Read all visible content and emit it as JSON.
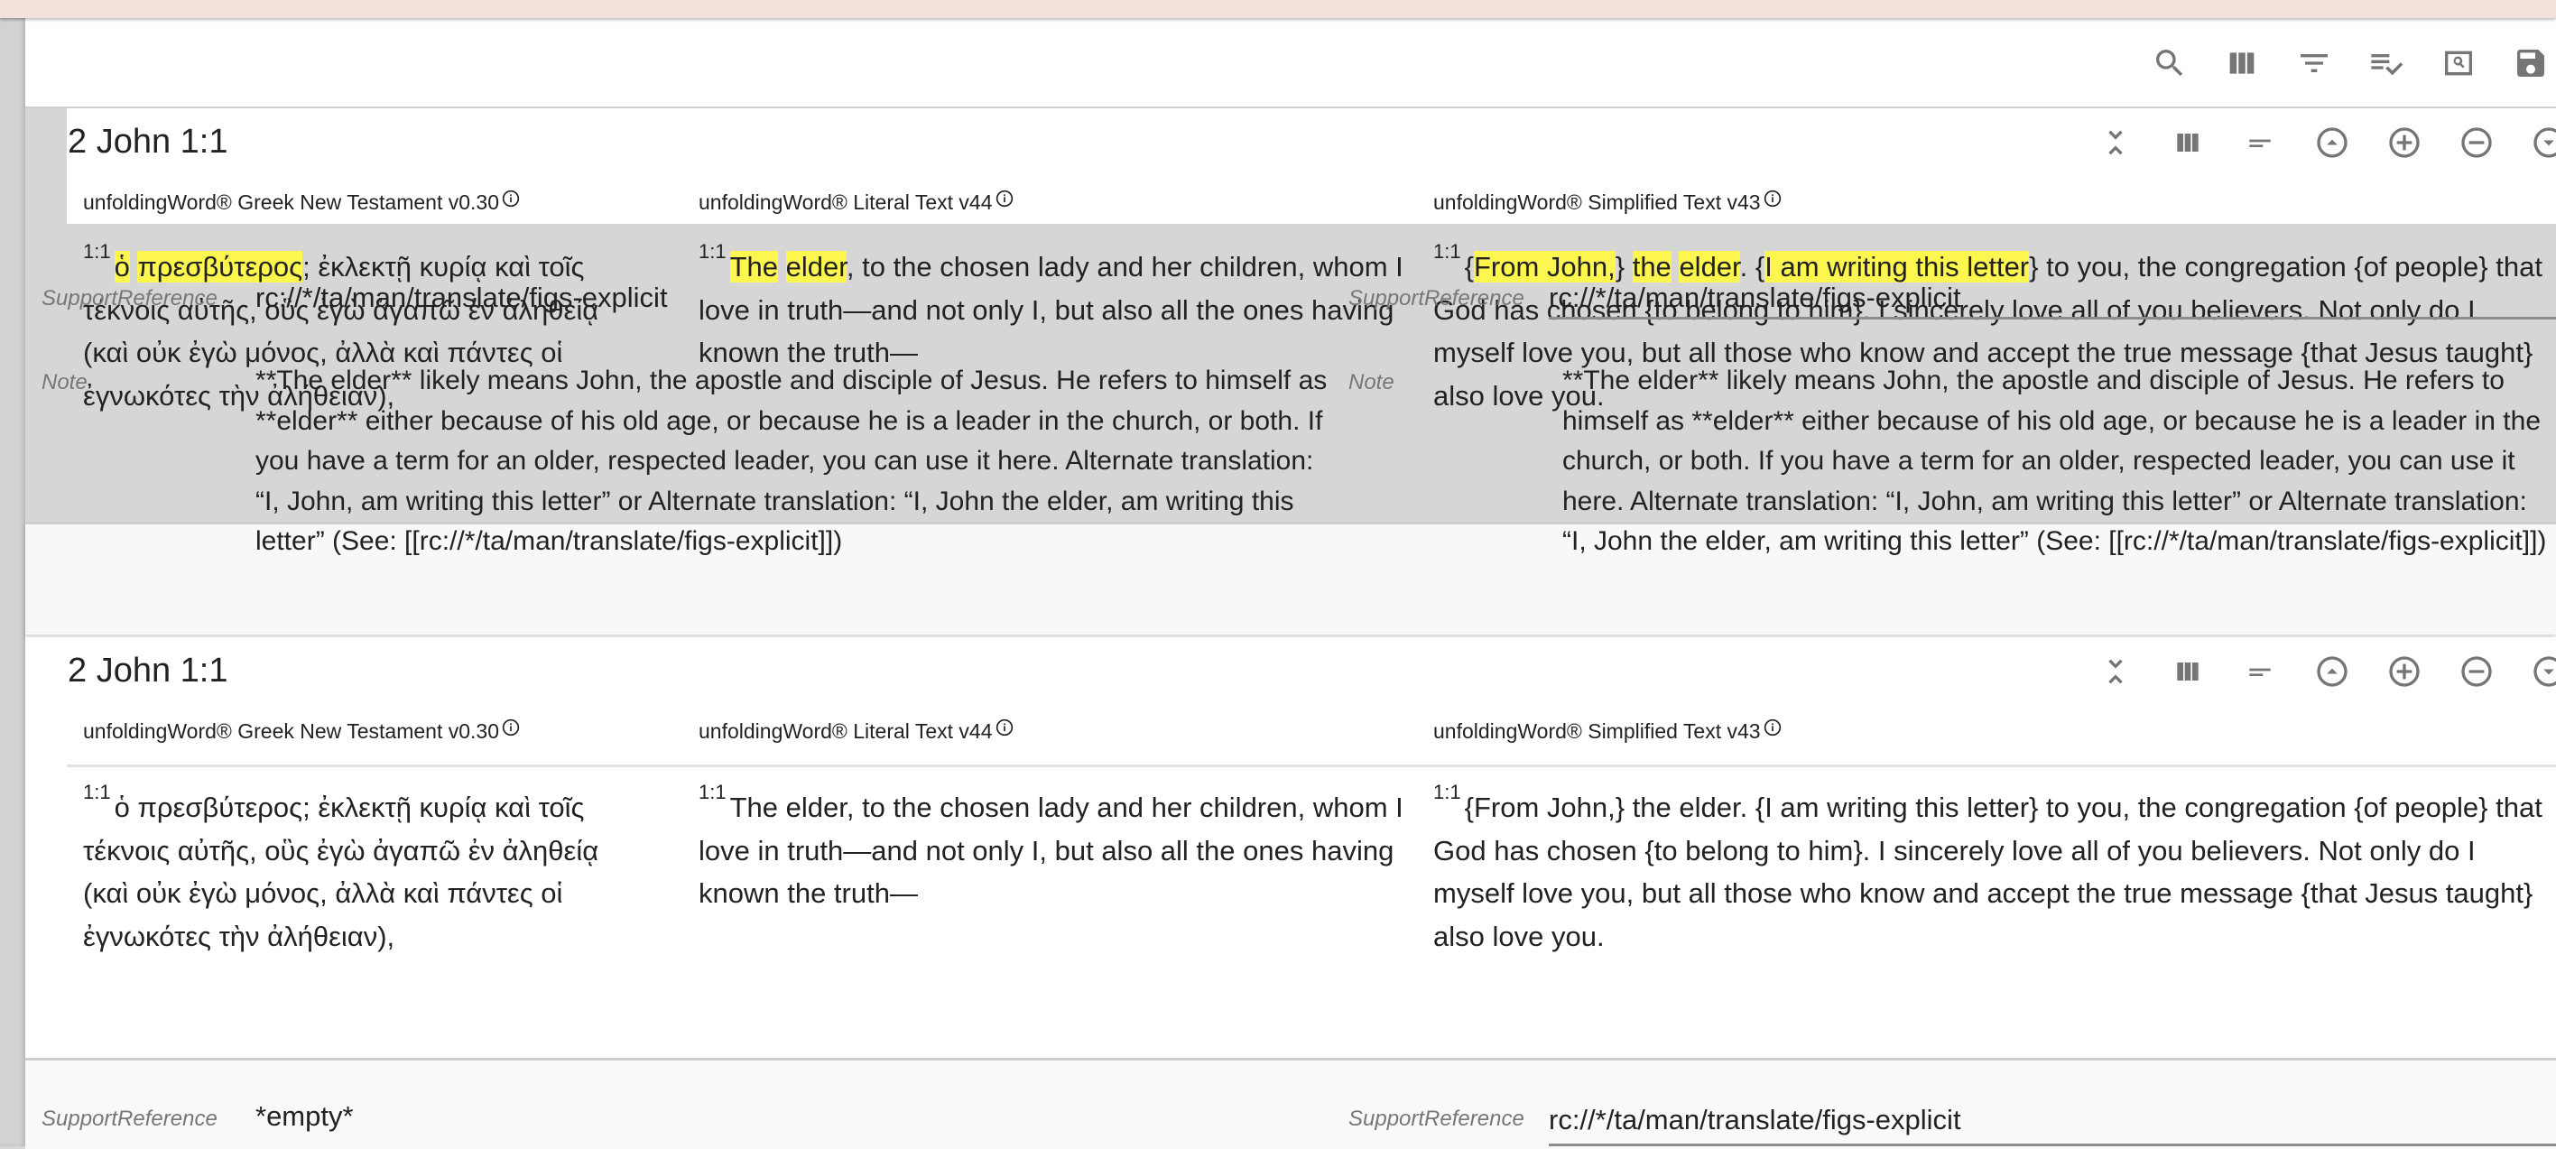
{
  "toolbar": {
    "icons": [
      "search-icon",
      "view-column-icon",
      "filter-icon",
      "playlist-check-icon",
      "preview-icon",
      "save-icon"
    ]
  },
  "cards": [
    {
      "title": "2 John 1:1",
      "icons": [
        "expand-collapse-icon",
        "view-column-icon",
        "sort-icon",
        "arrow-up-circle-icon",
        "add-circle-icon",
        "remove-circle-icon",
        "arrow-down-circle-icon"
      ],
      "resources": [
        {
          "title": "unfoldingWord® Greek New Testament v0.30",
          "verse_ref": "1:1",
          "segments": [
            {
              "text": "ὁ",
              "hl": true
            },
            {
              "text": " ",
              "hl": false
            },
            {
              "text": "πρεσβύτερος",
              "hl": true
            },
            {
              "text": "; ἐκλεκτῇ κυρίᾳ καὶ τοῖς τέκνοις αὐτῆς, οὓς ἐγὼ ἀγαπῶ ἐν ἀληθείᾳ",
              "hl": false
            }
          ],
          "verse_cont": "(καὶ οὐκ ἐγὼ μόνος, ἀλλὰ καὶ πάντες οἱ ἐγνωκότες τὴν ἀλήθειαν),"
        },
        {
          "title": "unfoldingWord® Literal Text v44",
          "verse_ref": "1:1",
          "segments": [
            {
              "text": "The",
              "hl": true
            },
            {
              "text": " ",
              "hl": false
            },
            {
              "text": "elder",
              "hl": true
            },
            {
              "text": ", to the chosen lady and her children, whom I love in truth—and not only I, but also all the ones having known the truth—",
              "hl": false
            }
          ]
        },
        {
          "title": "unfoldingWord® Simplified Text v43",
          "verse_ref": "1:1",
          "segments": [
            {
              "text": "{",
              "hl": false
            },
            {
              "text": "From John,",
              "hl": true
            },
            {
              "text": "} ",
              "hl": false
            },
            {
              "text": "the",
              "hl": true
            },
            {
              "text": " ",
              "hl": false
            },
            {
              "text": "elder",
              "hl": true
            },
            {
              "text": ". {",
              "hl": false
            },
            {
              "text": "I am writing this letter",
              "hl": true
            },
            {
              "text": "} to you, the congregation {of people} that God has chosen {to belong to him}. I sincerely love all of you believers. Not only do I myself love you, but all those who know and accept the true message {that Jesus taught} also love you.",
              "hl": false
            }
          ]
        }
      ],
      "fields": {
        "support_reference_label": "SupportReference",
        "support_reference_value": "rc://*/ta/man/translate/figs-explicit",
        "note_label": "Note",
        "note_value": "**The elder** likely means John, the apostle and disciple of Jesus. He refers to himself as **elder** either because of his old age, or because he is a leader in the church, or both. If you have a term for an older, respected leader, you can use it here. Alternate translation: “I, John, am writing this letter” or Alternate translation: “I, John the elder, am writing this letter” (See: [[rc://*/ta/man/translate/figs-explicit]])"
      }
    },
    {
      "title": "2 John 1:1",
      "icons": [
        "expand-collapse-icon",
        "view-column-icon",
        "sort-icon",
        "arrow-up-circle-icon",
        "add-circle-icon",
        "remove-circle-icon",
        "arrow-down-circle-icon"
      ],
      "resources": [
        {
          "title": "unfoldingWord® Greek New Testament v0.30",
          "verse_ref": "1:1",
          "text": "ὁ πρεσβύτερος; ἐκλεκτῇ κυρίᾳ καὶ τοῖς τέκνοις αὐτῆς, οὓς ἐγὼ ἀγαπῶ ἐν ἀληθείᾳ",
          "verse_cont": "(καὶ οὐκ ἐγὼ μόνος, ἀλλὰ καὶ πάντες οἱ ἐγνωκότες τὴν ἀλήθειαν),"
        },
        {
          "title": "unfoldingWord® Literal Text v44",
          "verse_ref": "1:1",
          "text": "The elder, to the chosen lady and her children, whom I love in truth—and not only I, but also all the ones having known the truth—"
        },
        {
          "title": "unfoldingWord® Simplified Text v43",
          "verse_ref": "1:1",
          "text": "{From John,} the elder. {I am writing this letter} to you, the congregation {of people} that God has chosen {to belong to him}. I sincerely love all of you believers. Not only do I myself love you, but all those who know and accept the true message {that Jesus taught} also love you."
        }
      ],
      "fields": {
        "left_support_reference_label": "SupportReference",
        "left_support_reference_value": "*empty*",
        "right_support_reference_label": "SupportReference",
        "right_support_reference_value": "rc://*/ta/man/translate/figs-explicit"
      }
    }
  ],
  "colors": {
    "highlight": "#fdf64e",
    "icon": "#757575",
    "topbar": "#f3e2dc"
  }
}
